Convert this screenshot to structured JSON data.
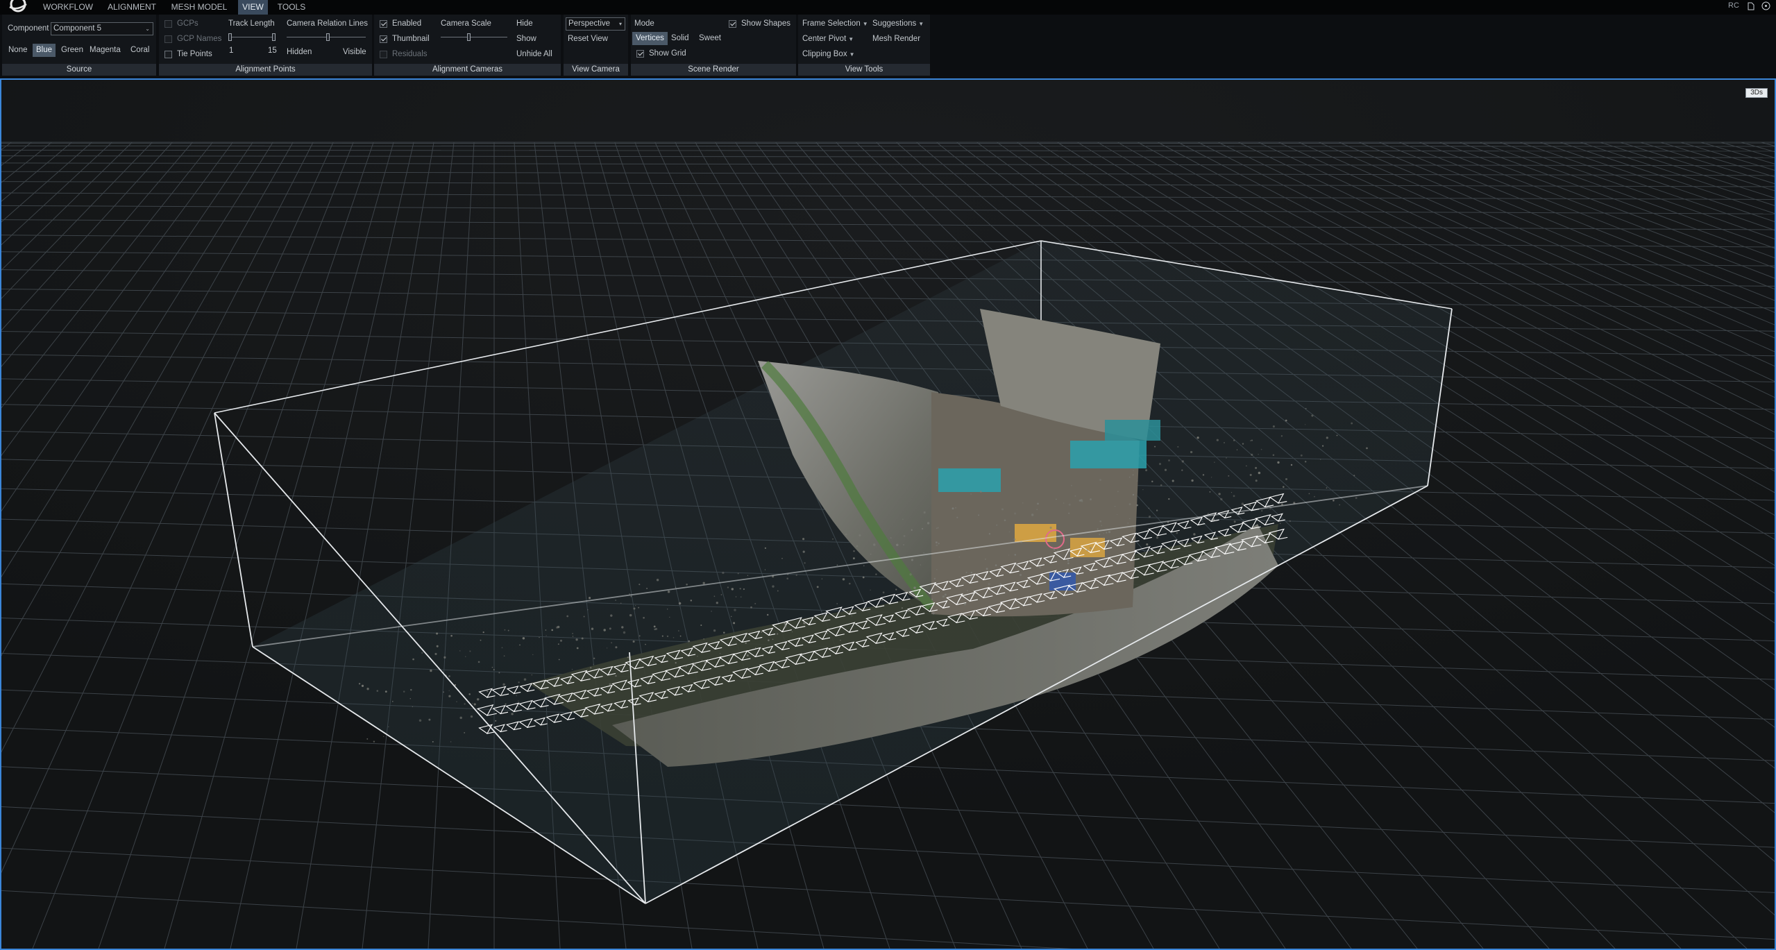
{
  "menu": {
    "tabs": [
      {
        "label": "WORKFLOW"
      },
      {
        "label": "ALIGNMENT"
      },
      {
        "label": "MESH MODEL"
      },
      {
        "label": "VIEW"
      },
      {
        "label": "TOOLS"
      }
    ],
    "active_tab": "VIEW",
    "right_label": "RC"
  },
  "source": {
    "title": "Source",
    "component_label": "Component",
    "component_value": "Component 5",
    "colors": [
      "None",
      "Blue",
      "Green",
      "Magenta",
      "Coral"
    ],
    "active_color": "Blue"
  },
  "alignment_points": {
    "title": "Alignment Points",
    "gcps": "GCPs",
    "gcp_names": "GCP Names",
    "tie_points": "Tie Points",
    "track_length": "Track Length",
    "track_min": "1",
    "track_max": "15",
    "relation_lines": "Camera Relation Lines",
    "hidden": "Hidden",
    "visible": "Visible"
  },
  "alignment_cameras": {
    "title": "Alignment Cameras",
    "enabled": "Enabled",
    "thumbnail": "Thumbnail",
    "residuals": "Residuals",
    "camera_scale": "Camera Scale",
    "hide": "Hide",
    "show": "Show",
    "unhide_all": "Unhide All"
  },
  "view_camera": {
    "title": "View Camera",
    "projection": "Perspective",
    "reset_view": "Reset View"
  },
  "scene_render": {
    "title": "Scene Render",
    "mode_label": "Mode",
    "modes": [
      "Vertices",
      "Solid",
      "Sweet"
    ],
    "active_mode": "Vertices",
    "show_shapes": "Show Shapes",
    "show_grid": "Show Grid"
  },
  "view_tools": {
    "title": "View Tools",
    "frame_selection": "Frame Selection",
    "suggestions": "Suggestions",
    "center_pivot": "Center Pivot",
    "mesh_render": "Mesh Render",
    "clipping_box": "Clipping Box"
  },
  "viewport": {
    "tag": "3Ds",
    "accent": "#3b86d9",
    "grid_color": "#4a5259",
    "box_color": "#e6e9ec",
    "object_colors": [
      "#8a8a86",
      "#4a6b3c",
      "#2aa1ad",
      "#d9a441",
      "#ffffff"
    ]
  }
}
